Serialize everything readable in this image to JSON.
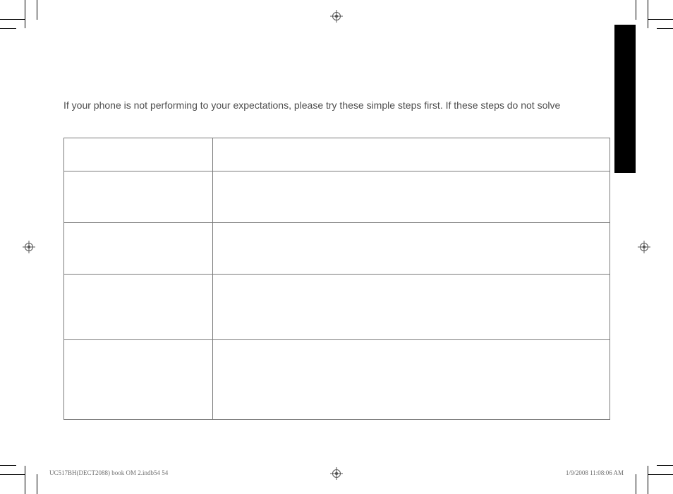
{
  "intro_text": "If your phone is not performing to your expectations, please try these simple steps first. If these steps do not solve",
  "table": {
    "rows": [
      {
        "c1": "",
        "c2": ""
      },
      {
        "c1": "",
        "c2": ""
      },
      {
        "c1": "",
        "c2": ""
      },
      {
        "c1": "",
        "c2": ""
      },
      {
        "c1": "",
        "c2": ""
      }
    ]
  },
  "footer": {
    "left": "UC517BH(DECT2088) book OM 2.indb54   54",
    "right": "1/9/2008   11:08:06 AM"
  }
}
